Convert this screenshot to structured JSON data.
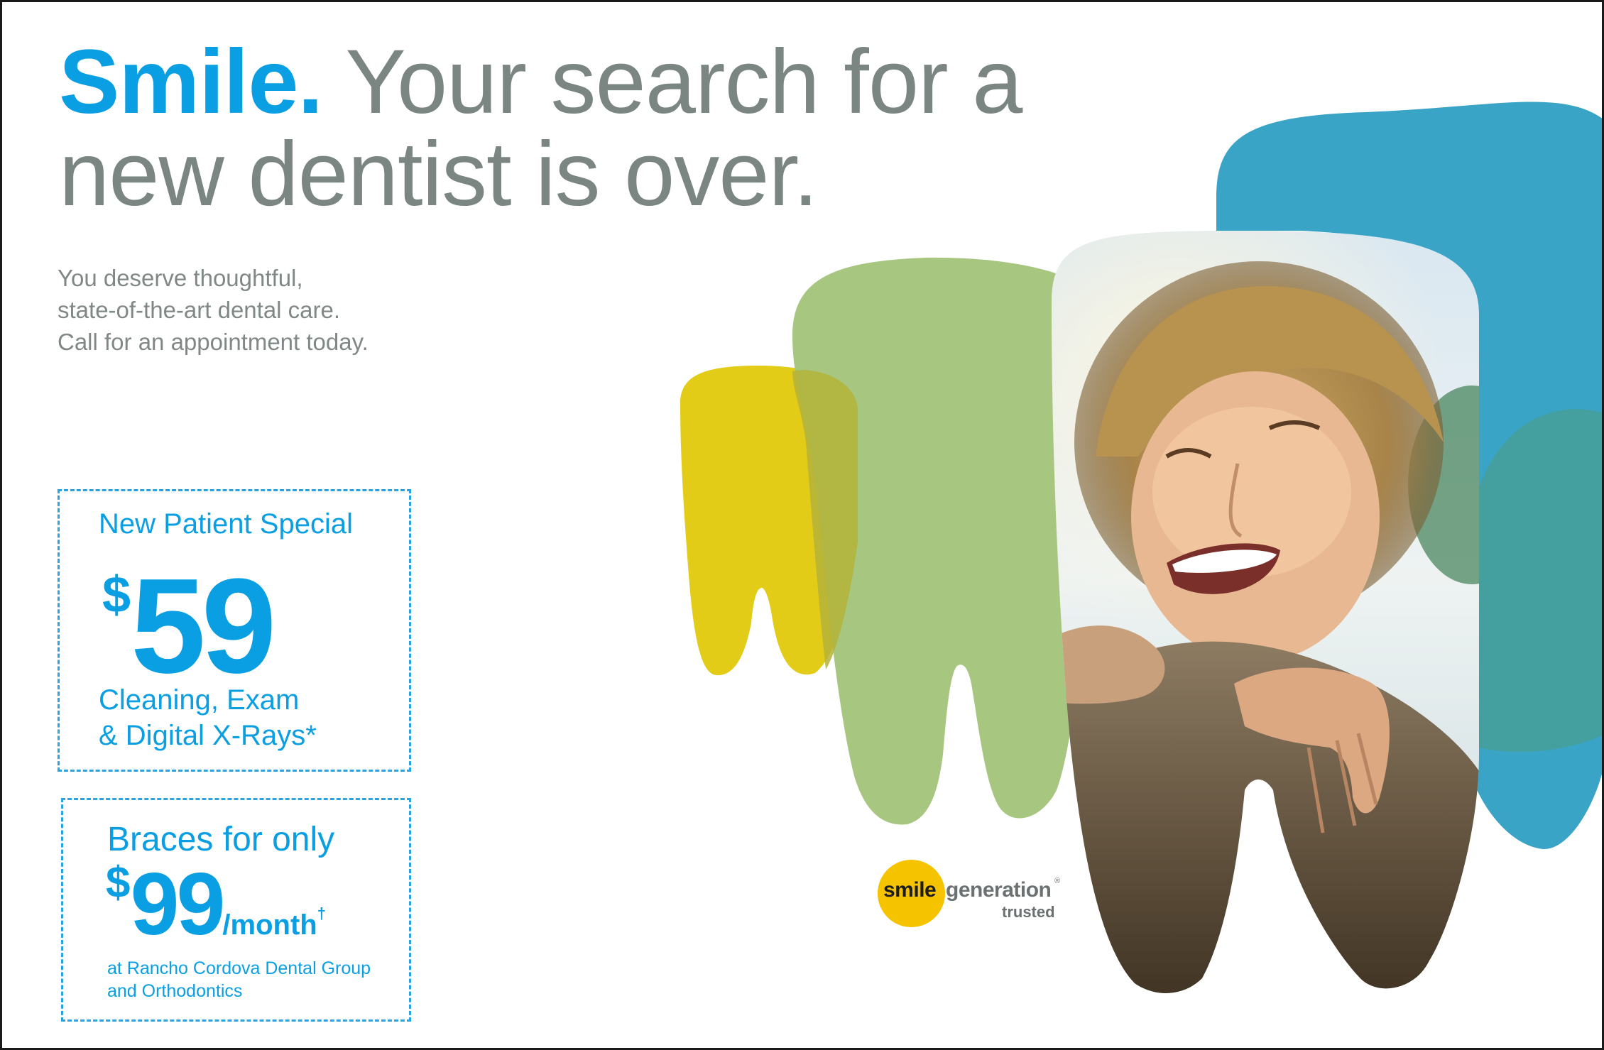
{
  "headline": {
    "accent": "Smile.",
    "rest_line1": " Your search for a",
    "line2": "new dentist is over."
  },
  "intro": {
    "line1": "You deserve thoughtful,",
    "line2": "state-of-the-art dental care.",
    "line3": "Call for an appointment today."
  },
  "offer_new_patient": {
    "title": "New Patient Special",
    "currency": "$",
    "amount": "59",
    "line1": "Cleaning, Exam",
    "line2": "& Digital X-Rays*"
  },
  "offer_braces": {
    "title": "Braces for only",
    "currency": "$",
    "amount": "99",
    "per": "/month",
    "dagger": "†",
    "foot1": "at Rancho Cordova Dental Group",
    "foot2": "and Orthodontics"
  },
  "logo": {
    "word1": "smile",
    "word2": "generation",
    "reg": "®",
    "tagline": "trusted"
  },
  "colors": {
    "accent_blue": "#0a9ee3",
    "text_gray": "#7b8581",
    "tooth_yellow": "#e2cc17",
    "tooth_green": "#a2c47a",
    "tooth_blue": "#3aa4c6",
    "logo_yellow": "#f6c300"
  }
}
